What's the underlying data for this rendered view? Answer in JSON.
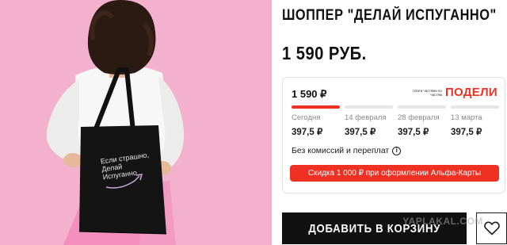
{
  "product": {
    "title": "ШОППЕР \"ДЕЛАЙ ИСПУГАННО\"",
    "price": "1 590 РУБ.",
    "bag_print": [
      "Если страшно,",
      "Делай",
      "Испуганно"
    ]
  },
  "installments": {
    "total": "1 590 ₽",
    "brand_tagline": "плати частями по частям",
    "brand_logo": "ПОДЕЛИ",
    "schedule": [
      {
        "date": "Сегодня",
        "amount": "397,5 ₽",
        "active": true
      },
      {
        "date": "14 февраля",
        "amount": "397,5 ₽",
        "active": false
      },
      {
        "date": "28 февраля",
        "amount": "397,5 ₽",
        "active": false
      },
      {
        "date": "13 марта",
        "amount": "397,5 ₽",
        "active": false
      }
    ],
    "no_fee_text": "Без комиссий и переплат",
    "promo_text": "Скидка 1 000 ₽ при оформлении Альфа-Карты"
  },
  "actions": {
    "add_to_cart": "ДОБАВИТЬ В КОРЗИНУ"
  },
  "watermark": "YAPLAKAL.COM",
  "icons": {
    "info": "info-icon",
    "favorite": "heart-icon"
  },
  "colors": {
    "accent": "#ef3124",
    "background_photo": "#f2a9c8",
    "button": "#111111"
  }
}
